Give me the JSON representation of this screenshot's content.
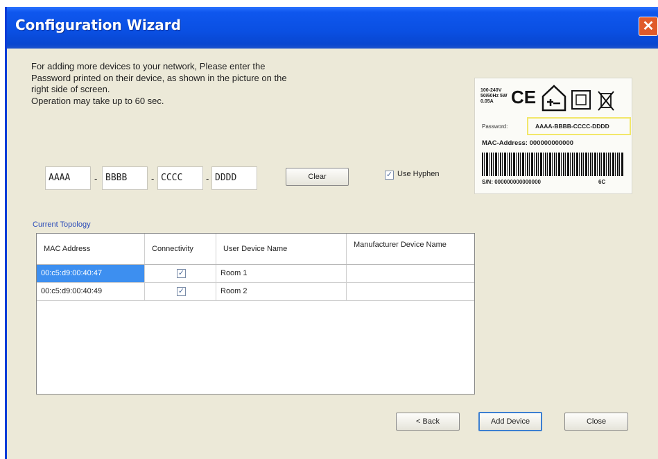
{
  "window": {
    "title": "Configuration Wizard",
    "close_glyph": "✕"
  },
  "instructions": {
    "line1": "For adding more devices to your network, Please enter the",
    "line2": "Password printed on their device, as shown in the picture on the",
    "line3": "right side of screen.",
    "line4": "Operation may take up to 60 sec."
  },
  "password": {
    "seg1": "AAAA",
    "seg2": "BBBB",
    "seg3": "CCCC",
    "seg4": "DDDD",
    "sep": "-"
  },
  "clear_label": "Clear",
  "use_hyphen": {
    "label": "Use Hyphen",
    "checked": true
  },
  "device_label": {
    "rating": "100-240V 50/60Hz 5W 0.05A",
    "password_label": "Password:",
    "password_value": "AAAA-BBBB-CCCC-DDDD",
    "mac_label": "MAC-Address: 000000000000",
    "serial": "S/N: 000000000000000",
    "code": "6C",
    "icons": [
      "ce-mark-icon",
      "house-plug-icon",
      "double-insulation-icon",
      "weee-bin-icon"
    ]
  },
  "topology": {
    "label": "Current Topology",
    "columns": [
      "MAC Address",
      "Connectivity",
      "User Device Name",
      "Manufacturer Device Name"
    ],
    "rows": [
      {
        "mac": "00:c5:d9:00:40:47",
        "connectivity": true,
        "user_name": "Room 1",
        "manufacturer_name": "",
        "selected": true
      },
      {
        "mac": "00:c5:d9:00:40:49",
        "connectivity": true,
        "user_name": "Room 2",
        "manufacturer_name": "",
        "selected": false
      }
    ]
  },
  "footer": {
    "back_label": "< Back",
    "add_device_label": "Add Device",
    "close_label": "Close"
  },
  "colors": {
    "title_bar": "#0a4fe2",
    "dialog_bg": "#ece9d8",
    "selection": "#3d8ff0",
    "highlight_box": "#f2e76a"
  }
}
